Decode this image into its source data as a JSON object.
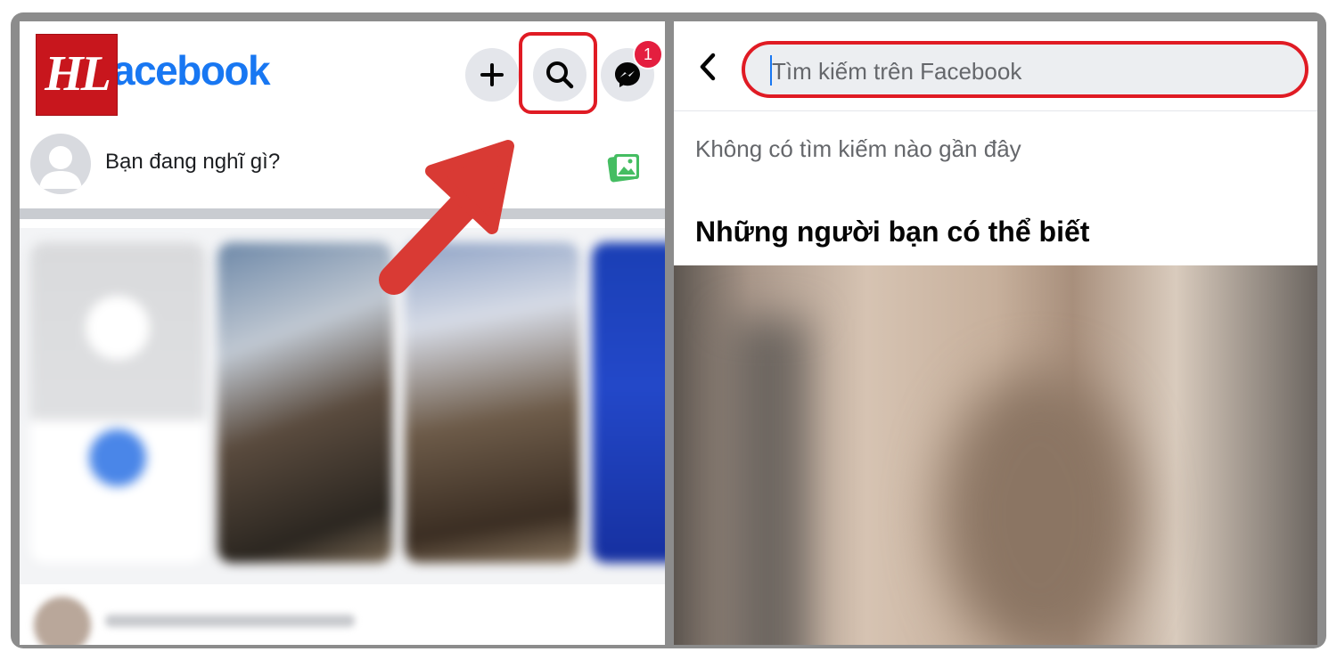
{
  "left": {
    "logo_text": "acebook",
    "watermark_text": "HL",
    "messenger_badge": "1",
    "composer_placeholder": "Bạn đang nghĩ gì?",
    "colors": {
      "brand": "#1877f2",
      "highlight": "#e01b24",
      "arrow": "#d93a34",
      "photo_icon": "#45bd62"
    },
    "icons": [
      "plus-icon",
      "search-icon",
      "messenger-icon",
      "photo-icon"
    ]
  },
  "right": {
    "search_placeholder": "Tìm kiếm trên Facebook",
    "no_recent_text": "Không có tìm kiếm nào gần đây",
    "pymk_title": "Những người bạn có thể biết",
    "icons": [
      "back-chevron-icon"
    ]
  }
}
